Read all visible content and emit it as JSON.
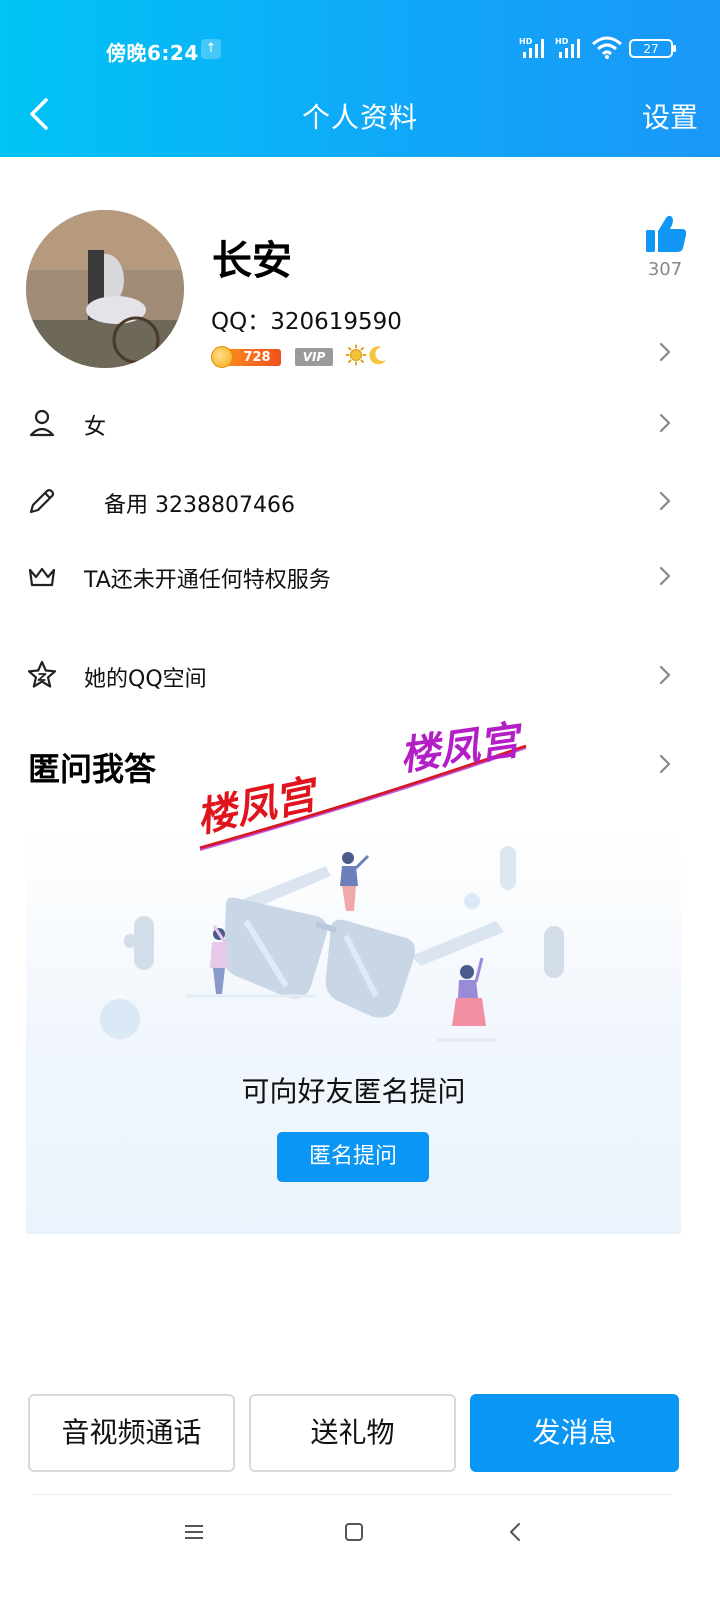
{
  "status_bar": {
    "time": "傍晚6:24",
    "upload_glyph": "↑",
    "signal_label_1": "HD",
    "signal_label_2": "HD",
    "battery": "27"
  },
  "nav": {
    "back_icon": "chevron-left-icon",
    "title": "个人资料",
    "settings": "设置"
  },
  "profile": {
    "name": "长安",
    "qq": "QQ：320619590",
    "coin_level": "728",
    "vip": "VIP",
    "like_count": "307"
  },
  "rows": [
    {
      "icon": "person-icon",
      "label": "女"
    },
    {
      "icon": "pencil-icon",
      "label": "备用 3238807466"
    },
    {
      "icon": "crown-icon",
      "label": "TA还未开通任何特权服务"
    },
    {
      "icon": "star-icon",
      "label": "她的QQ空间"
    }
  ],
  "qa": {
    "section_title": "匿问我答",
    "prompt": "可向好友匿名提问",
    "button": "匿名提问"
  },
  "watermark": {
    "text_left": "楼凤宫",
    "text_right": "楼凤宫"
  },
  "bottom_bar": {
    "call": "音视频通话",
    "gift": "送礼物",
    "message": "发消息"
  },
  "colors": {
    "accent": "#0a96f5",
    "header_start": "#00c4f5",
    "header_end": "#1a97f8"
  }
}
